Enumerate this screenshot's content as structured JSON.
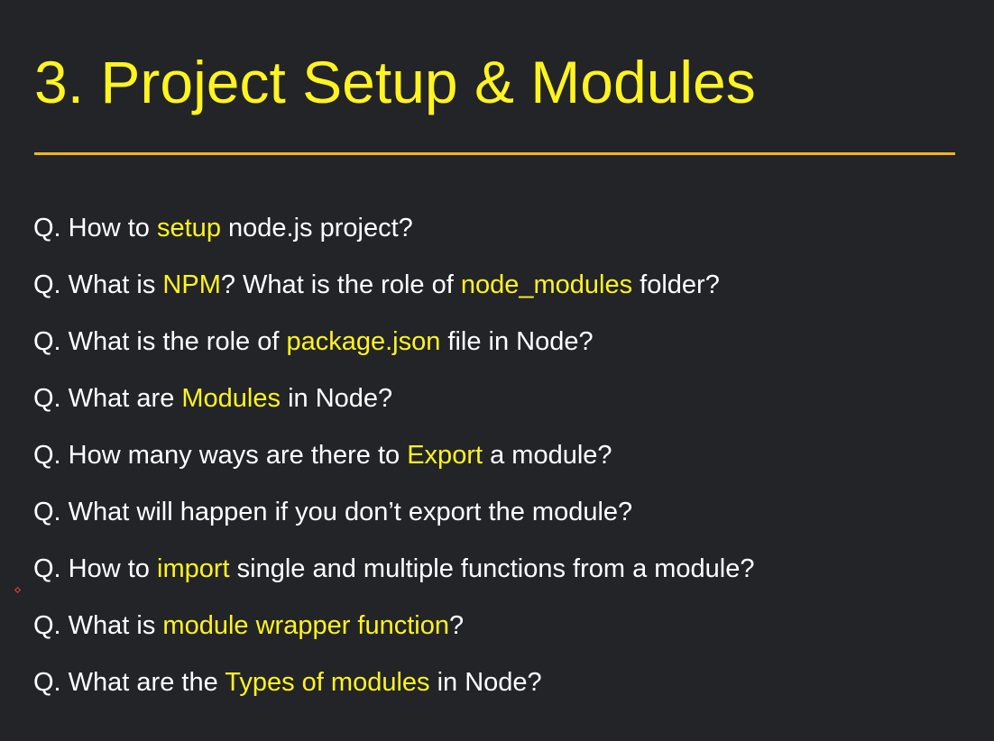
{
  "colors": {
    "background": "#222428",
    "title": "#fff41f",
    "text": "#ffffff",
    "highlight": "#fff41f",
    "rule": "#f2b51b",
    "marker": "#e0492b"
  },
  "title": "3. Project Setup & Modules",
  "questions": [
    {
      "segments": [
        {
          "text": "Q. How to ",
          "highlight": false
        },
        {
          "text": "setup",
          "highlight": true
        },
        {
          "text": " node.js project?",
          "highlight": false
        }
      ]
    },
    {
      "segments": [
        {
          "text": "Q. What is ",
          "highlight": false
        },
        {
          "text": "NPM",
          "highlight": true
        },
        {
          "text": "? What is the role of ",
          "highlight": false
        },
        {
          "text": "node_modules",
          "highlight": true
        },
        {
          "text": " folder?",
          "highlight": false
        }
      ]
    },
    {
      "segments": [
        {
          "text": "Q. What is the role of ",
          "highlight": false
        },
        {
          "text": "package.json",
          "highlight": true
        },
        {
          "text": " file in Node?",
          "highlight": false
        }
      ]
    },
    {
      "segments": [
        {
          "text": "Q. What are ",
          "highlight": false
        },
        {
          "text": "Modules",
          "highlight": true
        },
        {
          "text": " in Node?",
          "highlight": false
        }
      ]
    },
    {
      "segments": [
        {
          "text": "Q. How many ways are there to ",
          "highlight": false
        },
        {
          "text": "Export",
          "highlight": true
        },
        {
          "text": " a module?",
          "highlight": false
        }
      ]
    },
    {
      "segments": [
        {
          "text": "Q. What will happen if you don’t export the module?",
          "highlight": false
        }
      ]
    },
    {
      "segments": [
        {
          "text": "Q. How to ",
          "highlight": false
        },
        {
          "text": "import",
          "highlight": true
        },
        {
          "text": " single and multiple functions from a module?",
          "highlight": false
        }
      ]
    },
    {
      "segments": [
        {
          "text": "Q. What is ",
          "highlight": false
        },
        {
          "text": "module wrapper function",
          "highlight": true
        },
        {
          "text": "?",
          "highlight": false
        }
      ]
    },
    {
      "segments": [
        {
          "text": "Q. What are the ",
          "highlight": false
        },
        {
          "text": "Types of modules",
          "highlight": true
        },
        {
          "text": " in Node?",
          "highlight": false
        }
      ]
    }
  ]
}
